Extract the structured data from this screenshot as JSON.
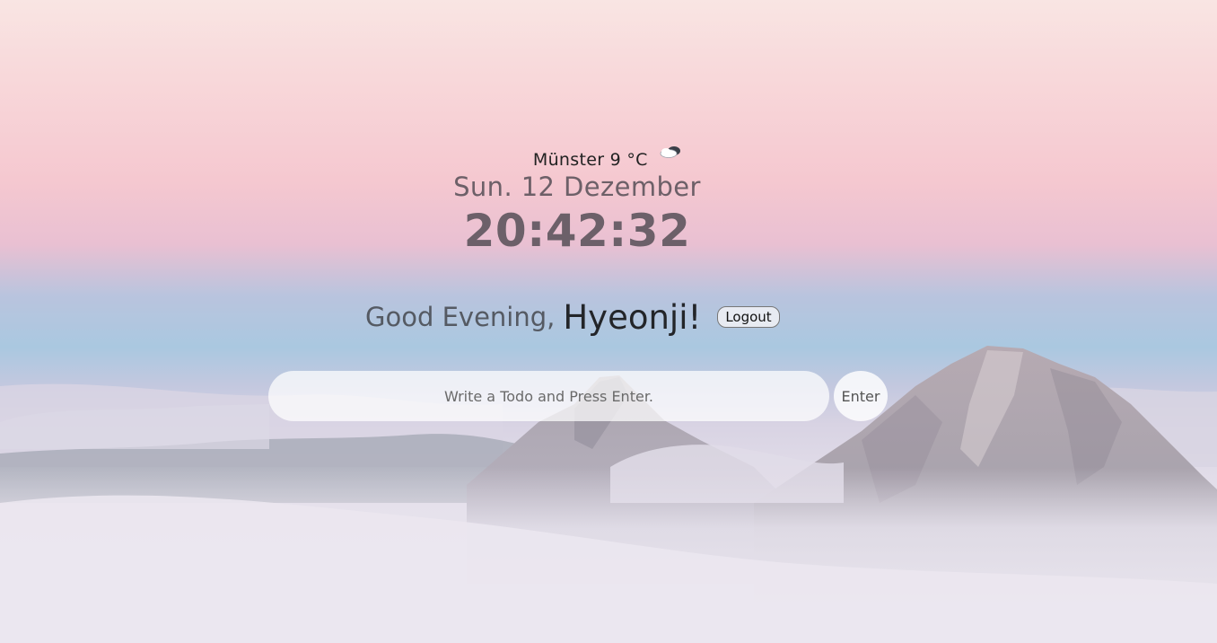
{
  "weather": {
    "text": "Münster 9 °C",
    "icon": "cloud-icon"
  },
  "date": "Sun. 12 Dezember",
  "clock": "20:42:32",
  "greeting": {
    "prefix": "Good Evening,",
    "name": "Hyeonji!",
    "logout_label": "Logout"
  },
  "todo": {
    "placeholder": "Write a Todo and Press Enter.",
    "value": "",
    "enter_label": "Enter"
  }
}
